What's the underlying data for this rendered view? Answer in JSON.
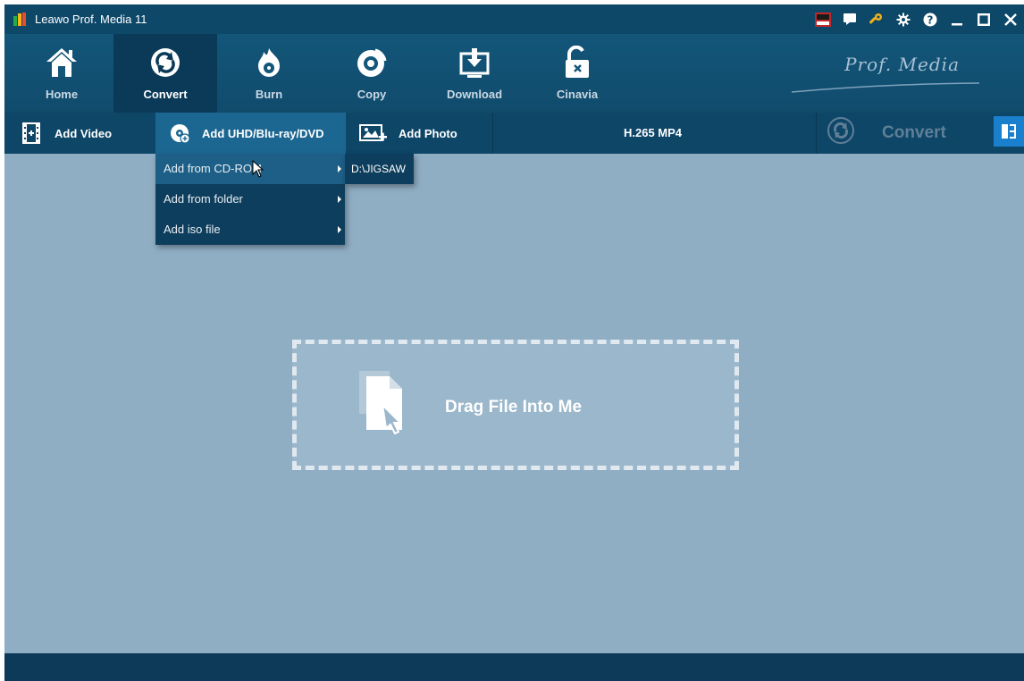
{
  "window": {
    "title": "Leawo Prof. Media 11"
  },
  "titlebar_icons": [
    {
      "name": "amd-badge-icon"
    },
    {
      "name": "feedback-icon"
    },
    {
      "name": "register-key-icon"
    },
    {
      "name": "settings-gear-icon"
    },
    {
      "name": "help-icon"
    },
    {
      "name": "minimize-icon"
    },
    {
      "name": "maximize-icon"
    },
    {
      "name": "close-icon"
    }
  ],
  "nav": {
    "items": [
      {
        "label": "Home",
        "icon": "home-icon"
      },
      {
        "label": "Convert",
        "icon": "convert-icon",
        "active": true
      },
      {
        "label": "Burn",
        "icon": "burn-icon"
      },
      {
        "label": "Copy",
        "icon": "copy-icon"
      },
      {
        "label": "Download",
        "icon": "download-icon"
      },
      {
        "label": "Cinavia",
        "icon": "cinavia-unlock-icon"
      }
    ],
    "brand": "Prof. Media"
  },
  "toolbar": {
    "add_video": "Add Video",
    "add_disc": "Add UHD/Blu-ray/DVD",
    "add_photo": "Add Photo",
    "format": "H.265 MP4",
    "convert": "Convert"
  },
  "menu": {
    "items": [
      {
        "label": "Add from CD-ROM"
      },
      {
        "label": "Add from folder"
      },
      {
        "label": "Add iso file"
      }
    ],
    "submenu_item": "D:\\JIGSAW"
  },
  "dropzone": {
    "text": "Drag File Into Me"
  },
  "colors": {
    "titlebar": "#0e4869",
    "nav_active": "#0a3a57",
    "toolbar": "#0e4668",
    "content_bg": "#8fadc3",
    "accent": "#1a7fcc",
    "key_icon": "#f2b318"
  }
}
